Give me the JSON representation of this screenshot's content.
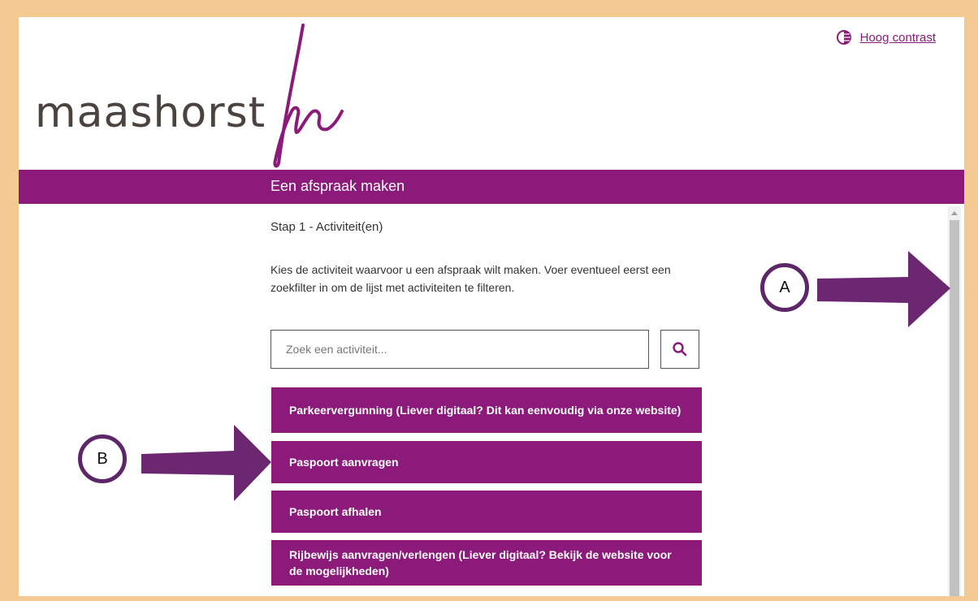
{
  "header": {
    "logo_text": "maashorst",
    "contrast_link": "Hoog contrast"
  },
  "banner": {
    "title": "Een afspraak maken"
  },
  "step": {
    "label": "Stap 1 - Activiteit(en)"
  },
  "intro": {
    "text": "Kies de activiteit waarvoor u een afspraak wilt maken. Voer eventueel eerst een zoekfilter in om de lijst met activiteiten te filteren."
  },
  "search": {
    "placeholder": "Zoek een activiteit..."
  },
  "activities": [
    "Parkeervergunning (Liever digitaal? Dit kan eenvoudig via onze website)",
    "Paspoort aanvragen",
    "Paspoort afhalen",
    "Rijbewijs aanvragen/verlengen (Liever digitaal? Bekijk de website voor de mogelijkheden)"
  ],
  "annotations": {
    "a": "A",
    "b": "B"
  },
  "colors": {
    "brand": "#8b1a7a",
    "frame": "#f5c992",
    "annotation": "#5c2668"
  }
}
